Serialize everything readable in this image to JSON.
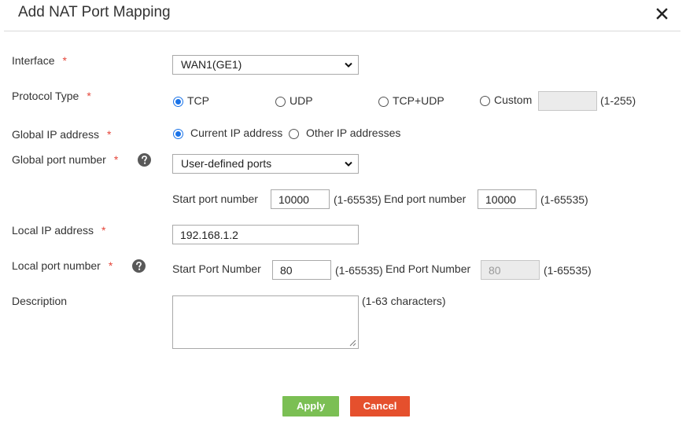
{
  "dialog": {
    "title": "Add NAT Port Mapping",
    "required_mark": "*"
  },
  "interface": {
    "label": "Interface",
    "value": "WAN1(GE1)"
  },
  "protocol": {
    "label": "Protocol Type",
    "options": [
      "TCP",
      "UDP",
      "TCP+UDP",
      "Custom"
    ],
    "selected": "TCP",
    "custom_value": "",
    "custom_range": "(1-255)"
  },
  "global_ip": {
    "label": "Global IP address",
    "options": [
      "Current IP address",
      "Other IP addresses"
    ],
    "selected": "Current IP address"
  },
  "global_port": {
    "label": "Global port number",
    "value": "User-defined ports",
    "start_label": "Start port number",
    "start_value": "10000",
    "start_range": "(1-65535)",
    "end_label": "End port number",
    "end_value": "10000",
    "end_range": "(1-65535)"
  },
  "local_ip": {
    "label": "Local IP address",
    "value": "192.168.1.2"
  },
  "local_port": {
    "label": "Local port number",
    "start_label": "Start Port Number",
    "start_value": "80",
    "start_range": "(1-65535)",
    "end_label": "End Port Number",
    "end_value": "80",
    "end_range": "(1-65535)"
  },
  "description": {
    "label": "Description",
    "value": "",
    "hint": "(1-63 characters)"
  },
  "actions": {
    "apply_label": "Apply",
    "cancel_label": "Cancel"
  },
  "colors": {
    "accent": "#1a73e8",
    "required": "#e5463a",
    "apply": "#7bbf54",
    "cancel": "#e5502d"
  }
}
